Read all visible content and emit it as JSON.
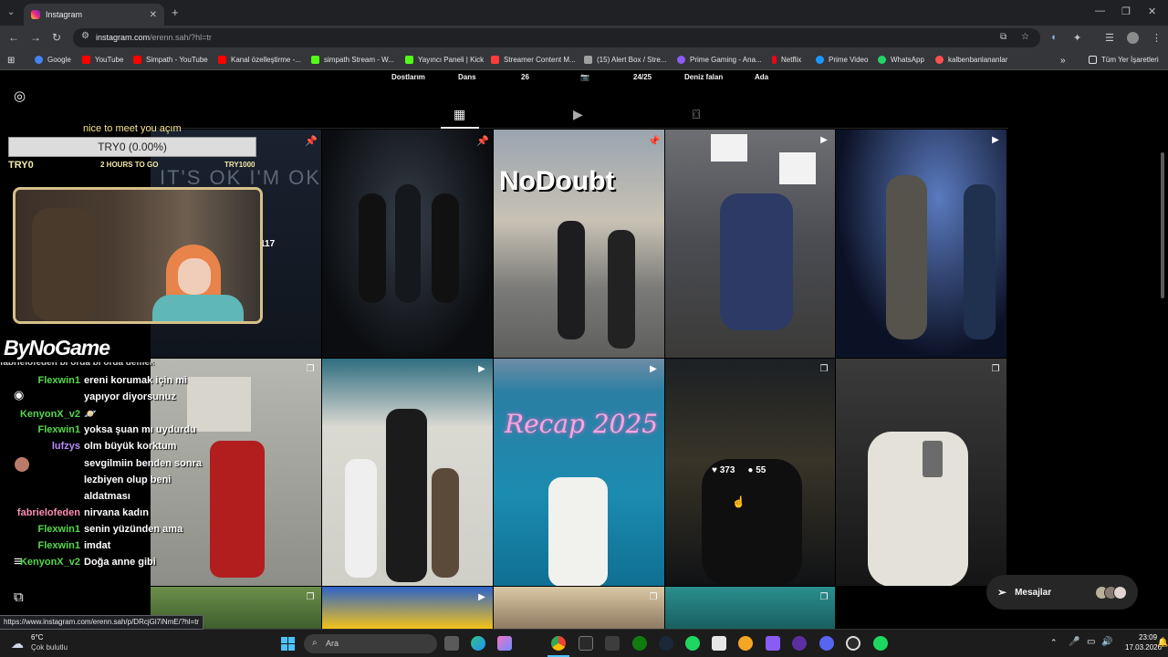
{
  "browser": {
    "tab_title": "Instagram",
    "url_host": "instagram.com",
    "url_path": "/erenn.sah/?hl=tr",
    "bookmarks": [
      "Google",
      "YouTube",
      "Simpath - YouTube",
      "Kanal özelleştirme -...",
      "simpath Stream - W...",
      "Yayıncı Paneli | Kick",
      "Streamer Content M...",
      "(15) Alert Box / Stre...",
      "Prime Gaming - Ana...",
      "Netflix",
      "Prime Video",
      "WhatsApp",
      "kalbenbanlananlar"
    ],
    "all_bookmarks": "Tüm Yer İşaretleri",
    "bookmark_colors": [
      "#4285f4",
      "#ff0000",
      "#ff0000",
      "#ff0000",
      "#53fc18",
      "#53fc18",
      "#ff3b3b",
      "#a0a0a0",
      "#8c5cf5",
      "#e50914",
      "#1a98ff",
      "#25d366",
      "#ff4f4f"
    ]
  },
  "profile": {
    "highlights": [
      "Dostlarım",
      "Dans",
      "26",
      "📷",
      "24/25",
      "Deniz falan",
      "Ada"
    ]
  },
  "grid": {
    "overlay_texts": [
      "NoDoubt",
      "Recap 2025"
    ],
    "hover_likes": "373",
    "hover_comments": "55",
    "side_count": "117"
  },
  "overlay": {
    "note": "nice to meet you açım",
    "goal_bar": "TRY0 (0.00%)",
    "goal_left": "TRY0",
    "goal_mid": "2 HOURS TO GO",
    "goal_right": "TRY1000",
    "brand": "ByNoGame",
    "partial_chat": "fabrielofeden  bi orda bi orda demek",
    "chat": [
      {
        "user": "Flexwin1",
        "msg": "ereni korumak için mi",
        "color": "#56d84b"
      },
      {
        "user": "",
        "msg": "yapıyor diyorsunuz",
        "color": "#56d84b"
      },
      {
        "user": "KenyonX_v2",
        "msg": "🪐",
        "color": "#56d84b"
      },
      {
        "user": "Flexwin1",
        "msg": "yoksa şuan mı uydurdu",
        "color": "#56d84b"
      },
      {
        "user": "lufzys",
        "msg": "olm büyük korktum",
        "color": "#b98cff"
      },
      {
        "user": "",
        "msg": "sevgilmiin benden sonra",
        "color": "#b98cff"
      },
      {
        "user": "",
        "msg": "lezbiyen olup beni",
        "color": "#b98cff"
      },
      {
        "user": "",
        "msg": "aldatması",
        "color": "#b98cff"
      },
      {
        "user": "fabrielofeden",
        "msg": "nirvana kadın",
        "color": "#ff8fb1"
      },
      {
        "user": "Flexwin1",
        "msg": "senin yüzünden ama",
        "color": "#56d84b"
      },
      {
        "user": "Flexwin1",
        "msg": "imdat",
        "color": "#56d84b"
      },
      {
        "user": "KenyonX_v2",
        "msg": "Doğa anne gibi",
        "color": "#56d84b"
      }
    ]
  },
  "messages_label": "Mesajlar",
  "status_url": "https://www.instagram.com/erenn.sah/p/DRcjGl7iNmE/?hl=tr",
  "taskbar": {
    "weather_temp": "6°C",
    "weather_desc": "Çok bulutlu",
    "search_placeholder": "Ara",
    "time": "23:09",
    "date": "17.03.2026"
  }
}
